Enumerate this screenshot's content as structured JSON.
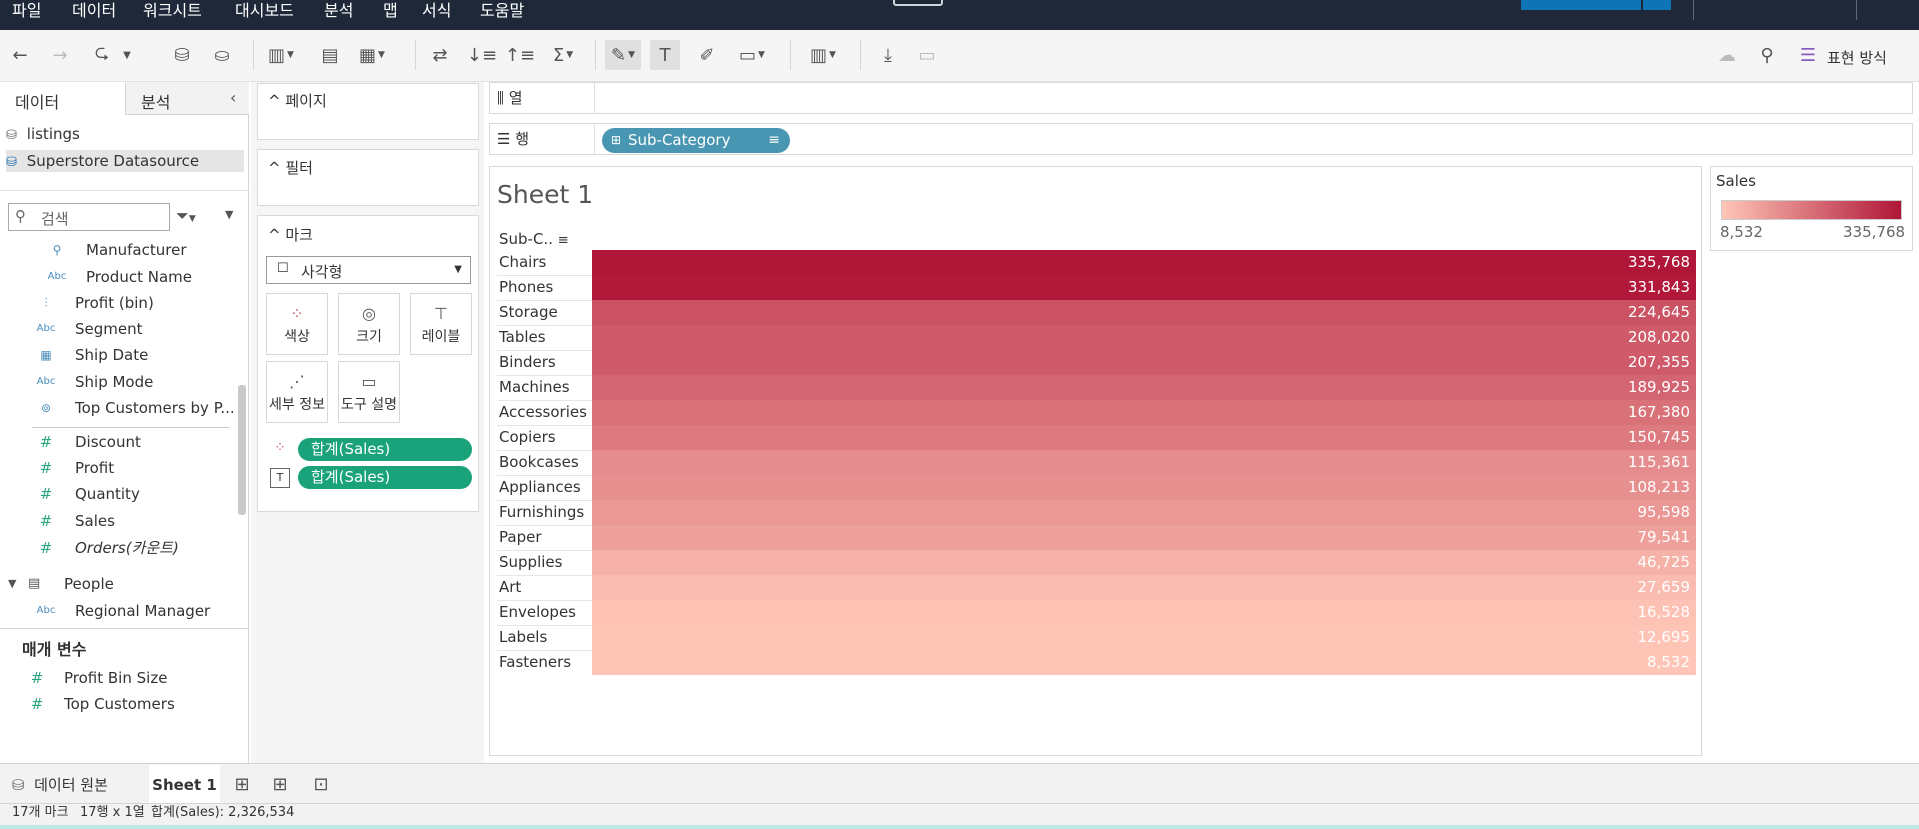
{
  "menu": [
    "파일",
    "데이터",
    "워크시트",
    "대시보드",
    "분석",
    "맵",
    "서식",
    "도움말"
  ],
  "toolbar": {
    "show_me": "표현 방식"
  },
  "data_pane": {
    "tab_data": "데이터",
    "tab_analysis": "분석",
    "sources": [
      "listings",
      "Superstore Datasource"
    ],
    "search_placeholder": "검색",
    "dimension_fields": [
      {
        "label": "Manufacturer",
        "icon": "paperclip-icon"
      },
      {
        "label": "Product Name",
        "icon": "abc-icon"
      },
      {
        "label": "Profit (bin)",
        "icon": "bin-icon"
      },
      {
        "label": "Segment",
        "icon": "abc-icon"
      },
      {
        "label": "Ship Date",
        "icon": "calendar-icon"
      },
      {
        "label": "Ship Mode",
        "icon": "abc-icon"
      },
      {
        "label": "Top Customers by P...",
        "icon": "set-icon"
      }
    ],
    "measure_fields": [
      "Discount",
      "Profit",
      "Quantity",
      "Sales",
      "Orders(카운트)"
    ],
    "folder": "People",
    "folder_fields": [
      "Regional Manager"
    ],
    "params_header": "매개 변수",
    "params": [
      "Profit Bin Size",
      "Top Customers"
    ]
  },
  "cards": {
    "pages": "페이지",
    "filters": "필터",
    "marks": "마크",
    "mark_type": "사각형",
    "buttons": [
      "색상",
      "크기",
      "레이블",
      "세부 정보",
      "도구 설명"
    ],
    "pills": [
      "합계(Sales)",
      "합계(Sales)"
    ]
  },
  "shelves": {
    "columns_label": "열",
    "rows_label": "행",
    "rows_pill": "Sub-Category"
  },
  "view": {
    "sheet_title": "Sheet 1",
    "column_header": "Sub-C..",
    "rows": [
      {
        "label": "Chairs",
        "value": "335,768"
      },
      {
        "label": "Phones",
        "value": "331,843"
      },
      {
        "label": "Storage",
        "value": "224,645"
      },
      {
        "label": "Tables",
        "value": "208,020"
      },
      {
        "label": "Binders",
        "value": "207,355"
      },
      {
        "label": "Machines",
        "value": "189,925"
      },
      {
        "label": "Accessories",
        "value": "167,380"
      },
      {
        "label": "Copiers",
        "value": "150,745"
      },
      {
        "label": "Bookcases",
        "value": "115,361"
      },
      {
        "label": "Appliances",
        "value": "108,213"
      },
      {
        "label": "Furnishings",
        "value": "95,598"
      },
      {
        "label": "Paper",
        "value": "79,541"
      },
      {
        "label": "Supplies",
        "value": "46,725"
      },
      {
        "label": "Art",
        "value": "27,659"
      },
      {
        "label": "Envelopes",
        "value": "16,528"
      },
      {
        "label": "Labels",
        "value": "12,695"
      },
      {
        "label": "Fasteners",
        "value": "8,532"
      }
    ],
    "color_low": "#ffc6b7",
    "color_high": "#b01638"
  },
  "legend": {
    "title": "Sales",
    "min": "8,532",
    "max": "335,768"
  },
  "bottom_tabs": {
    "data_source": "데이터 원본",
    "sheet": "Sheet 1"
  },
  "status": {
    "marks": "17개 마크",
    "dims": "17행 x 1열",
    "sum": "합계(Sales): 2,326,534"
  }
}
